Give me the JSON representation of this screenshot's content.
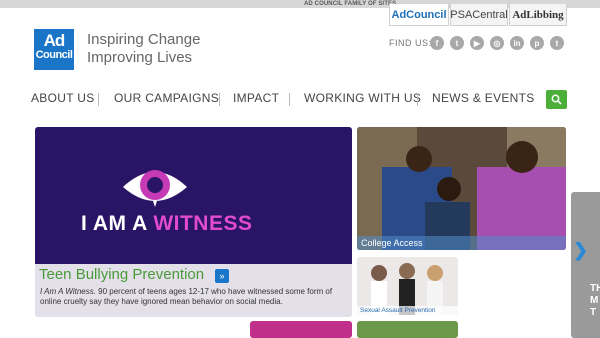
{
  "top_bar": {
    "family_label": "AD COUNCIL FAMILY OF SITES",
    "sites": [
      {
        "label": "AdCouncil"
      },
      {
        "label": "PSACentral"
      },
      {
        "label": "AdLibbing"
      }
    ]
  },
  "header": {
    "logo": {
      "line1": "Ad",
      "line2": "Council"
    },
    "tagline_1": "Inspiring Change",
    "tagline_2": "Improving Lives",
    "find_us": "FIND US:",
    "social": [
      {
        "icon": "facebook-icon",
        "glyph": "f"
      },
      {
        "icon": "twitter-icon",
        "glyph": "t"
      },
      {
        "icon": "youtube-icon",
        "glyph": "▶"
      },
      {
        "icon": "instagram-icon",
        "glyph": "◎"
      },
      {
        "icon": "linkedin-icon",
        "glyph": "in"
      },
      {
        "icon": "pinterest-icon",
        "glyph": "p"
      },
      {
        "icon": "tumblr-icon",
        "glyph": "t"
      }
    ]
  },
  "nav": {
    "items": [
      "ABOUT US",
      "OUR CAMPAIGNS",
      "IMPACT",
      "WORKING WITH US",
      "NEWS & EVENTS"
    ],
    "search_icon": "search-icon"
  },
  "hero": {
    "image_text_1": "I AM A ",
    "image_text_2": "WITNESS",
    "title": "Teen Bullying Prevention",
    "arrow": "»",
    "desc_italic": "I Am A Witness.",
    "desc_rest": " 90 percent of teens ages 12-17 who have witnessed some form of online cruelty say they have ignored mean behavior on social media."
  },
  "tiles": {
    "college": "College Access",
    "sexual": "Sexual Assault Prevention",
    "side_text": "TH\nM\nT"
  },
  "colors": {
    "brand_blue": "#1a75c9",
    "nav_green": "#4caf3a",
    "hero_purple": "#2a1466",
    "title_green": "#4a9a3a"
  }
}
